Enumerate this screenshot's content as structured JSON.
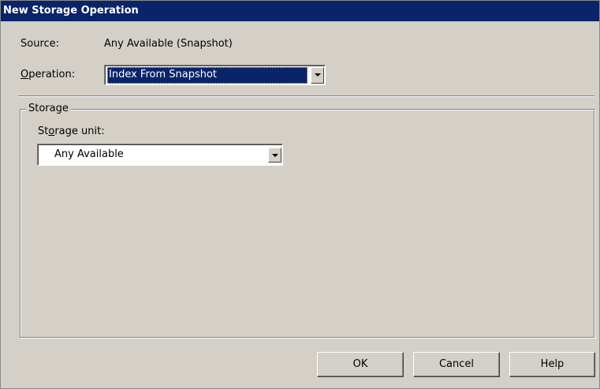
{
  "dialog": {
    "title": "New Storage Operation"
  },
  "source": {
    "label": "Source:",
    "value": "Any Available (Snapshot)"
  },
  "operation": {
    "label_prefix": "",
    "label_accel": "O",
    "label_rest": "peration:",
    "selected": "Index From Snapshot"
  },
  "storage_group": {
    "title": "Storage",
    "unit_label_prefix": "St",
    "unit_label_accel": "o",
    "unit_label_rest": "rage unit:",
    "unit_selected": "Any Available"
  },
  "buttons": {
    "ok": "OK",
    "cancel": "Cancel",
    "help": "Help"
  },
  "colors": {
    "titlebar": "#0a246a",
    "dialog_face": "#d4d0c8",
    "selection": "#0a246a"
  }
}
